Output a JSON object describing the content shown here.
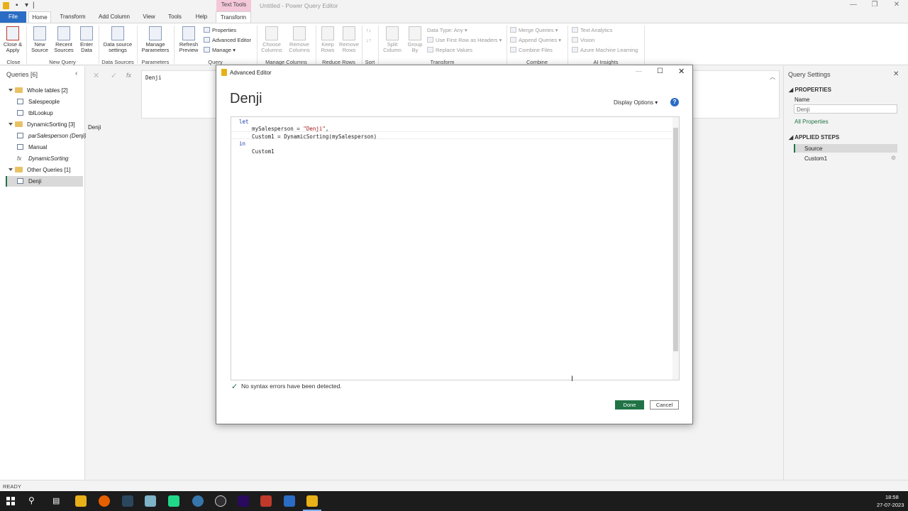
{
  "titlebar": {
    "contextual_tab": "Text Tools",
    "title": "Untitled - Power Query Editor"
  },
  "tabs": [
    "File",
    "Home",
    "Transform",
    "Add Column",
    "View",
    "Tools",
    "Help",
    "Transform"
  ],
  "ribbon": {
    "close_apply": "Close &",
    "close_apply2": "Apply",
    "new_source": "New",
    "new_source2": "Source",
    "recent_sources": "Recent",
    "recent_sources2": "Sources",
    "enter_data": "Enter",
    "enter_data2": "Data",
    "data_source_settings": "Data source",
    "data_source_settings2": "settings",
    "manage_parameters": "Manage",
    "manage_parameters2": "Parameters",
    "refresh_preview": "Refresh",
    "refresh_preview2": "Preview",
    "properties": "Properties",
    "advanced_editor": "Advanced Editor",
    "manage": "Manage",
    "choose_columns": "Choose",
    "choose_columns2": "Columns",
    "remove_columns": "Remove",
    "remove_columns2": "Columns",
    "keep_rows": "Keep",
    "keep_rows2": "Rows",
    "remove_rows": "Remove",
    "remove_rows2": "Rows",
    "split_column": "Split",
    "split_column2": "Column",
    "group_by": "Group",
    "group_by2": "By",
    "data_type": "Data Type: Any",
    "use_first_row": "Use First Row as Headers",
    "replace_values": "Replace Values",
    "merge_queries": "Merge Queries",
    "append_queries": "Append Queries",
    "combine_files": "Combine Files",
    "text_analytics": "Text Analytics",
    "vision": "Vision",
    "azure_ml": "Azure Machine Learning",
    "groups": [
      "Close",
      "New Query",
      "Data Sources",
      "Parameters",
      "Query",
      "Manage Columns",
      "Reduce Rows",
      "Sort",
      "Transform",
      "Combine",
      "AI Insights"
    ]
  },
  "queries": {
    "header": "Queries [6]",
    "group1": "Whole tables [2]",
    "item_salespeople": "Salespeople",
    "item_tbllookup": "tblLookup",
    "group2": "DynamicSorting [3]",
    "item_par": "parSalesperson (Denji)",
    "item_manual": "Manual",
    "item_dynamic": "DynamicSorting",
    "group3": "Other Queries [1]",
    "item_denji": "Denji"
  },
  "formula_bar": {
    "value": "Denji"
  },
  "preview": {
    "cell": "Denji"
  },
  "settings": {
    "header": "Query Settings",
    "properties": "PROPERTIES",
    "name_label": "Name",
    "name_value": "Denji",
    "all_properties": "All Properties",
    "applied_steps": "APPLIED STEPS",
    "step1": "Source",
    "step2": "Custom1"
  },
  "dialog": {
    "window_title": "Advanced Editor",
    "heading": "Denji",
    "display_options": "Display Options",
    "code": {
      "l1": "let",
      "l2a": "    mySalesperson = ",
      "l2b": "\"Denji\"",
      "l2c": ",",
      "l3": "    Custom1 = DynamicSorting(mySalesperson)",
      "l4": "in",
      "l5": "    Custom1"
    },
    "status": "No syntax errors have been detected.",
    "done": "Done",
    "cancel": "Cancel"
  },
  "statusbar": {
    "text": "READY"
  },
  "clock": {
    "time": "18:58",
    "date": "27-07-2023"
  },
  "colors": {
    "accent": "#217346",
    "file_tab": "#2b6cc4",
    "context_tab": "#f4c7d9"
  }
}
